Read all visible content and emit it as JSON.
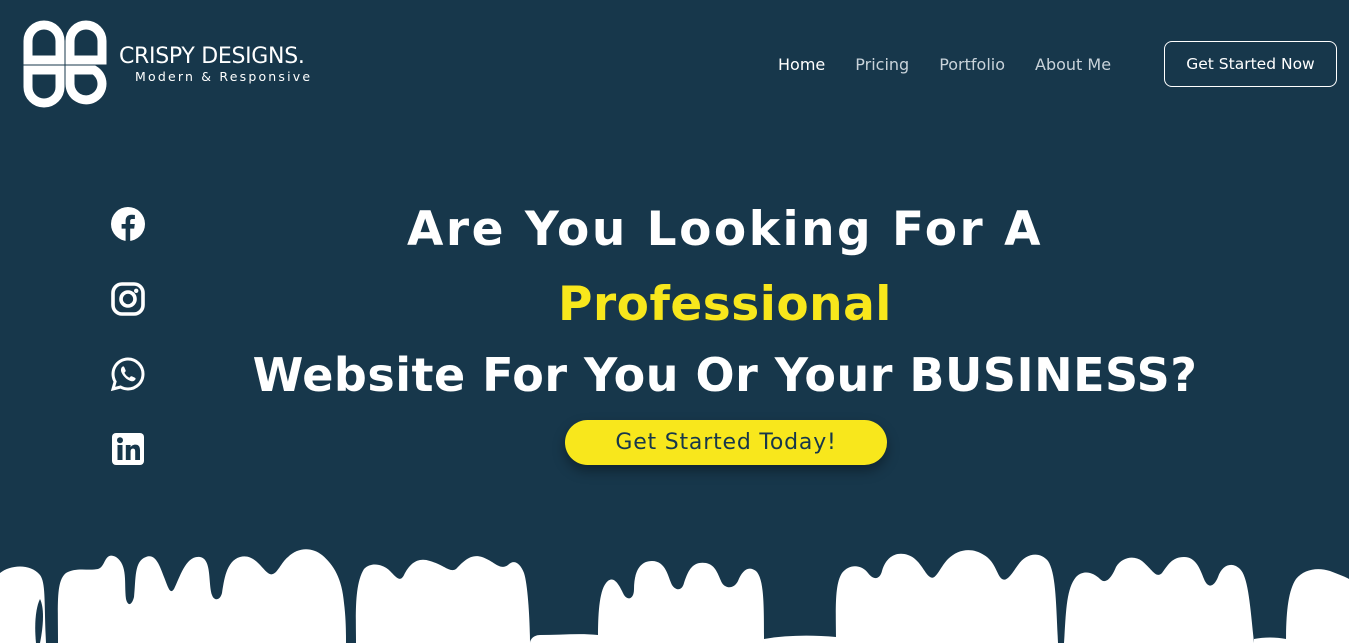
{
  "brand": {
    "name": "CRISPY DESIGNS.",
    "tagline": "Modern & Responsive"
  },
  "nav": {
    "items": [
      {
        "label": "Home",
        "active": true
      },
      {
        "label": "Pricing",
        "active": false
      },
      {
        "label": "Portfolio",
        "active": false
      },
      {
        "label": "About Me",
        "active": false
      }
    ],
    "cta_label": "Get Started Now"
  },
  "social": {
    "icons": [
      "facebook-icon",
      "instagram-icon",
      "whatsapp-icon",
      "linkedin-icon"
    ]
  },
  "hero": {
    "line1": "Are You Looking For A",
    "line2": "Professional",
    "line3": "Website For You Or Your BUSINESS?",
    "cta_label": "Get Started Today!"
  },
  "colors": {
    "background": "#17374b",
    "accent": "#f8e71c",
    "text": "#ffffff"
  }
}
